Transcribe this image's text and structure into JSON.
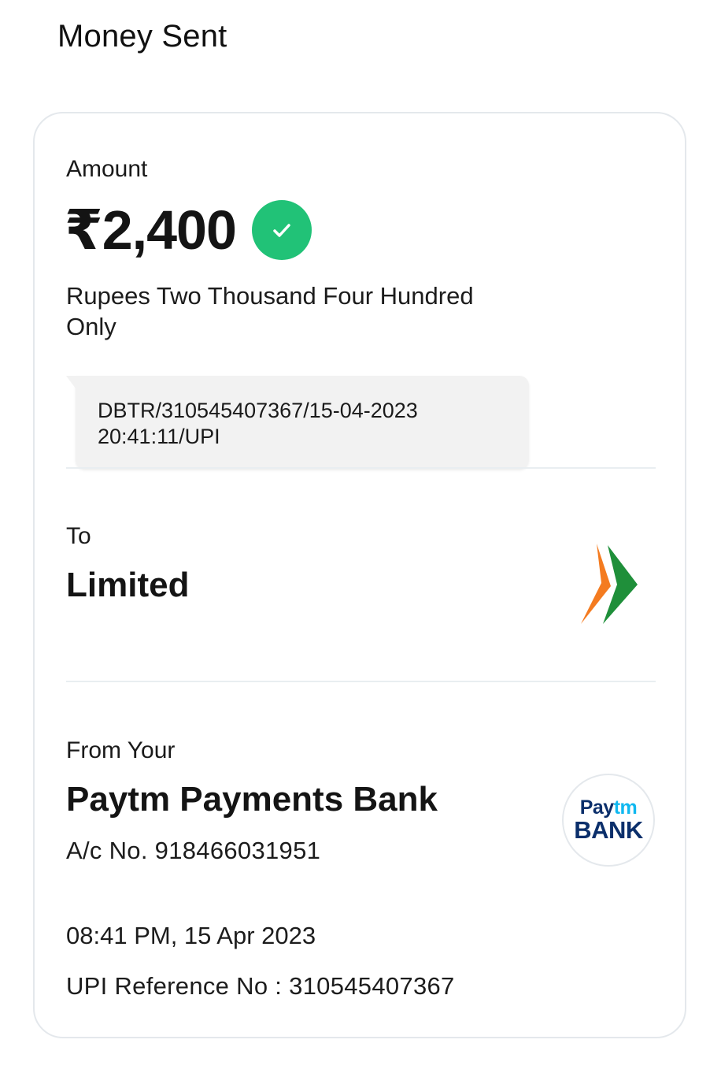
{
  "header": {
    "title": "Money Sent"
  },
  "amount": {
    "label": "Amount",
    "value": "₹2,400",
    "in_words": "Rupees Two Thousand Four Hundred Only",
    "status_icon": "check-circle-icon",
    "status_color": "#21c277"
  },
  "note": {
    "text": "DBTR/310545407367/15-04-2023 20:41:11/UPI"
  },
  "recipient": {
    "label": "To",
    "name": "Limited",
    "icon": "upi-logo-icon"
  },
  "sender": {
    "label": "From Your",
    "bank_name": "Paytm Payments Bank",
    "account": "A/c No. 918466031951",
    "logo": {
      "line1_part1": "Pay",
      "line1_part2": "tm",
      "line2": "BANK"
    }
  },
  "transaction": {
    "datetime": "08:41 PM, 15 Apr 2023",
    "upi_reference": "UPI Reference No : 310545407367"
  },
  "colors": {
    "brand_navy": "#0b2f6b",
    "brand_cyan": "#10b8f0",
    "success_green": "#21c277",
    "upi_orange": "#f47b20",
    "upi_green": "#1f8f3a"
  }
}
